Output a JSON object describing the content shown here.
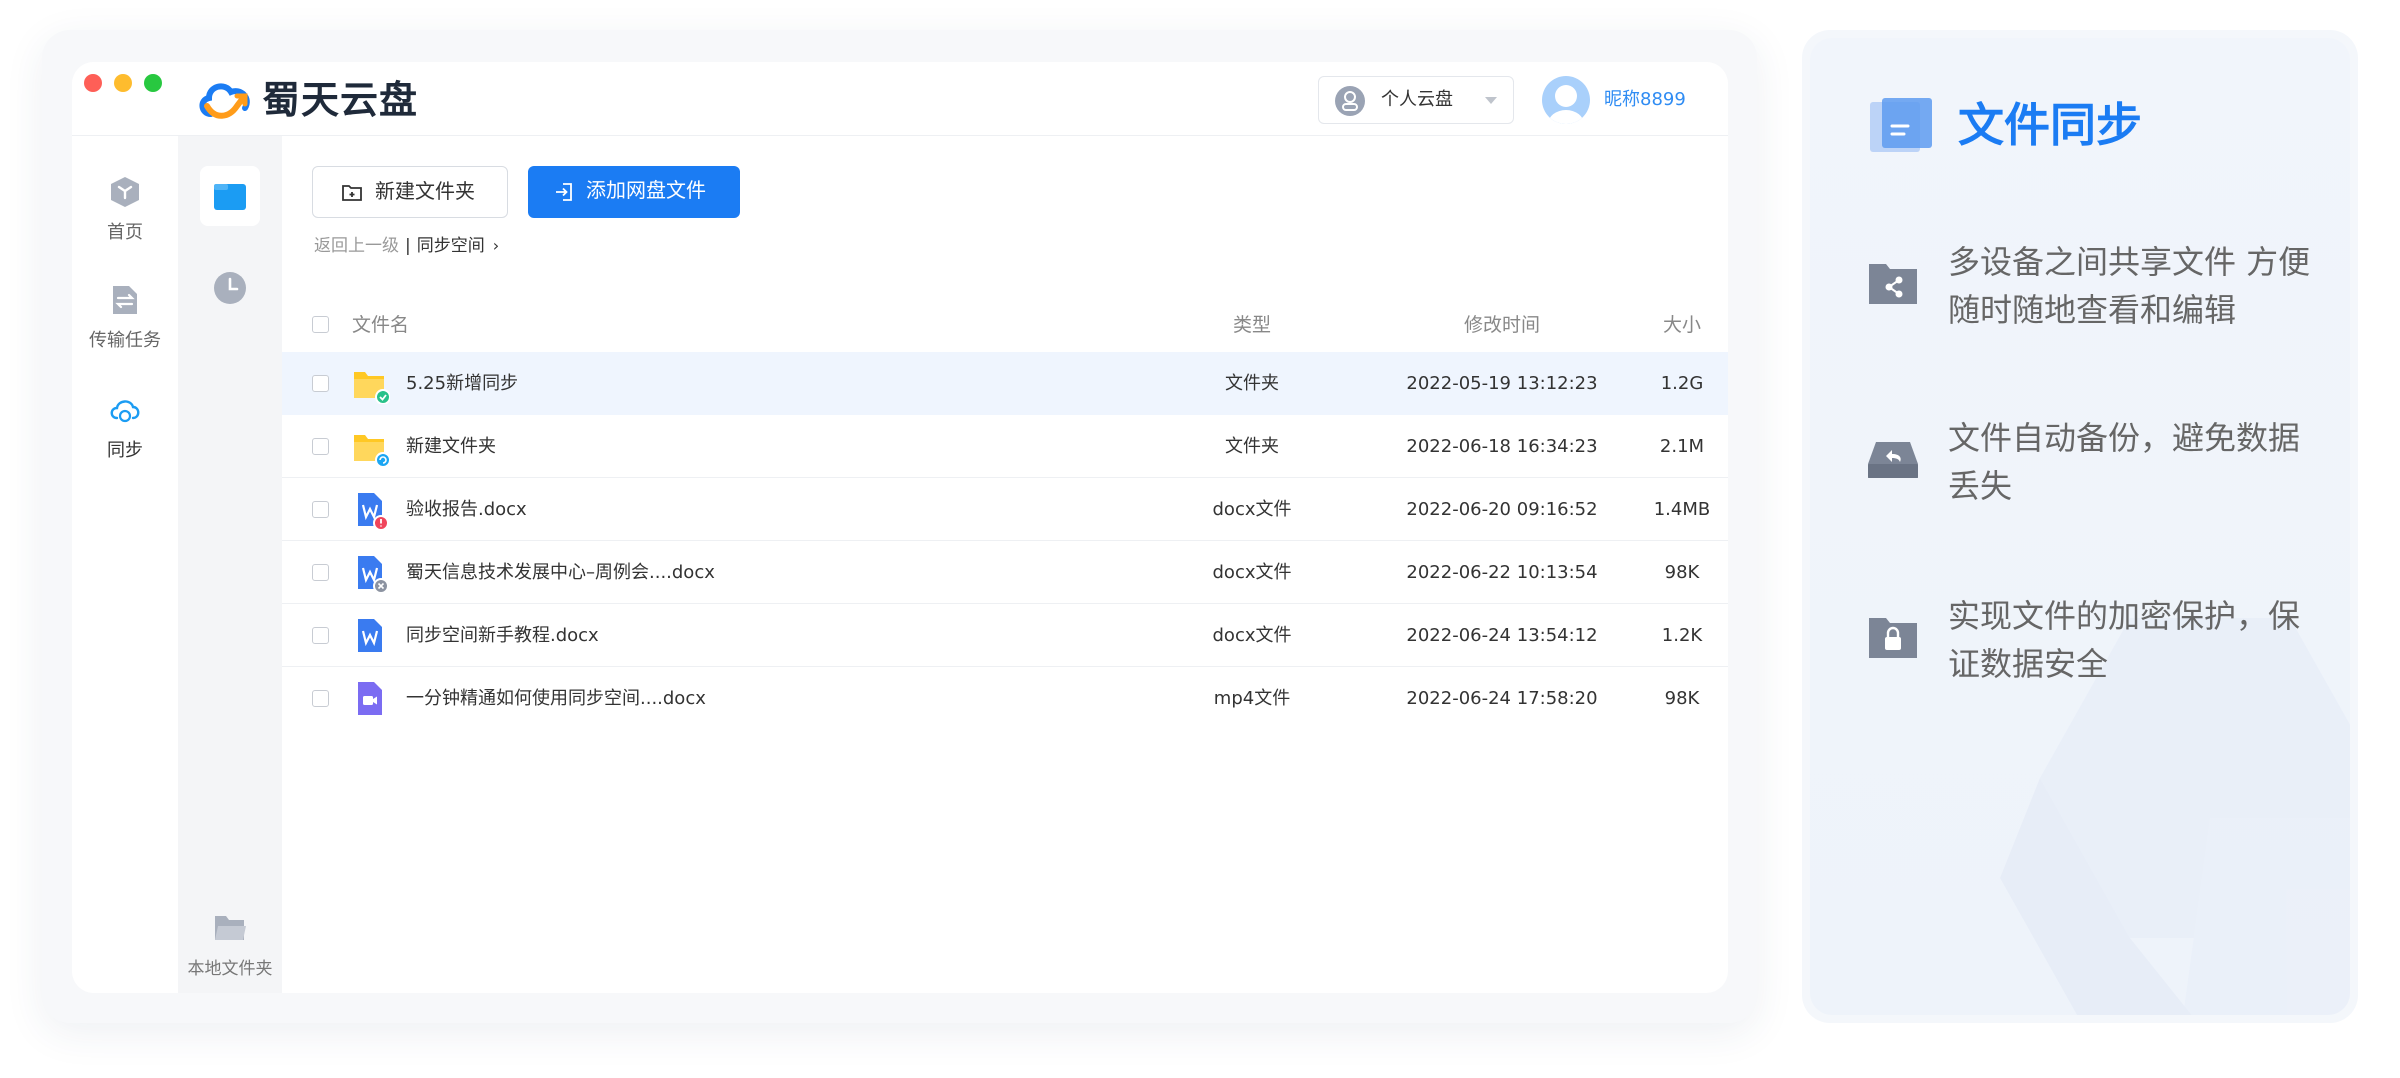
{
  "app": {
    "brand": "蜀天云盘",
    "space_selector": "个人云盘",
    "user_name": "昵称8899"
  },
  "nav": {
    "items": [
      {
        "label": "首页",
        "icon": "cube-icon"
      },
      {
        "label": "传输任务",
        "icon": "transfer-icon"
      },
      {
        "label": "同步",
        "icon": "cloud-sync-icon"
      }
    ]
  },
  "subnav": {
    "local_folder": "本地文件夹"
  },
  "toolbar": {
    "new_folder": "新建文件夹",
    "add_files": "添加网盘文件"
  },
  "breadcrumb": {
    "back": "返回上一级",
    "separator": "|",
    "current": "同步空间",
    "chevron": "›"
  },
  "table": {
    "headers": {
      "name": "文件名",
      "type": "类型",
      "modified": "修改时间",
      "size": "大小"
    },
    "rows": [
      {
        "name": "5.25新增同步",
        "type": "文件夹",
        "modified": "2022-05-19 13:12:23",
        "size": "1.2G",
        "icon": "folder-icon",
        "status": "synced-badge"
      },
      {
        "name": "新建文件夹",
        "type": "文件夹",
        "modified": "2022-06-18 16:34:23",
        "size": "2.1M",
        "icon": "folder-icon",
        "status": "syncing-badge"
      },
      {
        "name": "验收报告.docx",
        "type": "docx文件",
        "modified": "2022-06-20 09:16:52",
        "size": "1.4MB",
        "icon": "word-doc-icon",
        "status": "error-badge"
      },
      {
        "name": "蜀天信息技术发展中心–周例会....docx",
        "type": "docx文件",
        "modified": "2022-06-22 10:13:54",
        "size": "98K",
        "icon": "word-doc-icon",
        "status": "cancelled-badge"
      },
      {
        "name": "同步空间新手教程.docx",
        "type": "docx文件",
        "modified": "2022-06-24 13:54:12",
        "size": "1.2K",
        "icon": "word-doc-icon",
        "status": ""
      },
      {
        "name": "一分钟精通如何使用同步空间....docx",
        "type": "mp4文件",
        "modified": "2022-06-24 17:58:20",
        "size": "98K",
        "icon": "video-file-icon",
        "status": ""
      }
    ]
  },
  "feature": {
    "title": "文件同步",
    "items": [
      {
        "text": "多设备之间共享文件  方便随时随地查看和编辑",
        "icon": "share-folder-icon"
      },
      {
        "text": "文件自动备份，避免数据丢失",
        "icon": "backup-drive-icon"
      },
      {
        "text": "实现文件的加密保护，保证数据安全",
        "icon": "lock-folder-icon"
      }
    ]
  },
  "colors": {
    "accent": "#1b7cf3",
    "folder": "#ffc824",
    "word": "#3a7bf0",
    "video": "#7b6cf2"
  }
}
